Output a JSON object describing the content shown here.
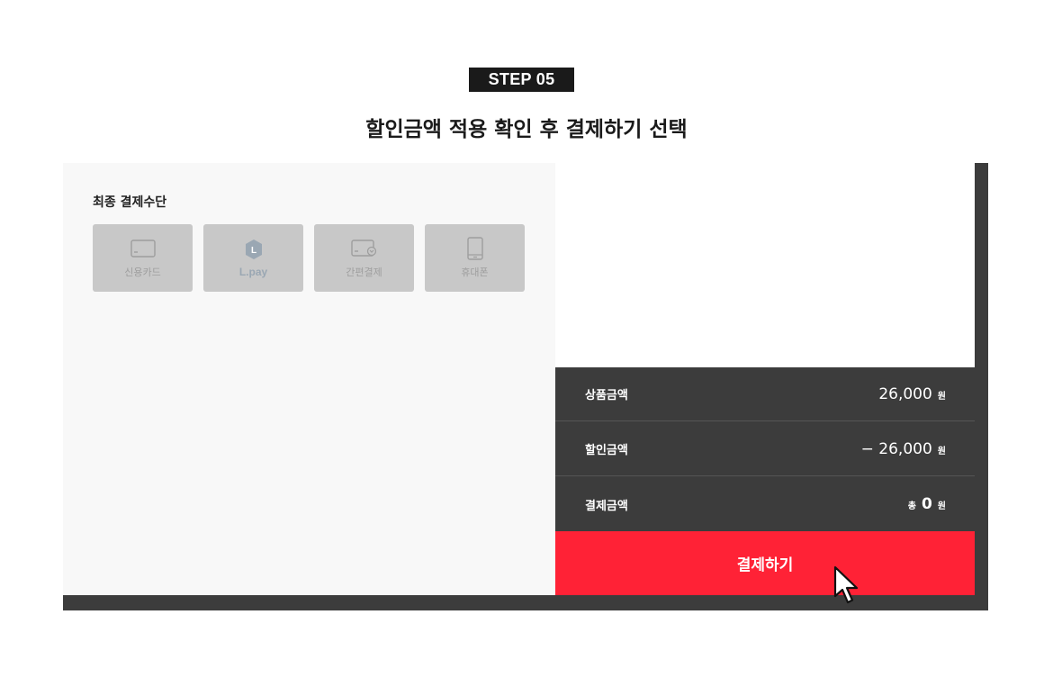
{
  "step": {
    "badge": "STEP 05"
  },
  "headline": "할인금액 적용 확인 후 결제하기 선택",
  "payment_methods": {
    "title": "최종 결제수단",
    "items": [
      {
        "label": "신용카드",
        "icon": "credit-card-icon"
      },
      {
        "label": "L.pay",
        "icon": "lpay-icon"
      },
      {
        "label": "간편결제",
        "icon": "easy-pay-icon"
      },
      {
        "label": "휴대폰",
        "icon": "mobile-phone-icon"
      }
    ]
  },
  "summary": {
    "product_amount": {
      "label": "상품금액",
      "value": "26,000",
      "unit": "원"
    },
    "discount_amount": {
      "label": "할인금액",
      "value": "− 26,000",
      "unit": "원"
    },
    "payment_amount": {
      "label": "결제금액",
      "prefix": "총",
      "value": "0",
      "unit": "원"
    }
  },
  "pay_button": {
    "label": "결제하기"
  },
  "colors": {
    "accent": "#ff2236",
    "dark": "#3c3c3c",
    "method_tile": "#c8c8c8",
    "lpay_blue": "#9aa7b3"
  }
}
